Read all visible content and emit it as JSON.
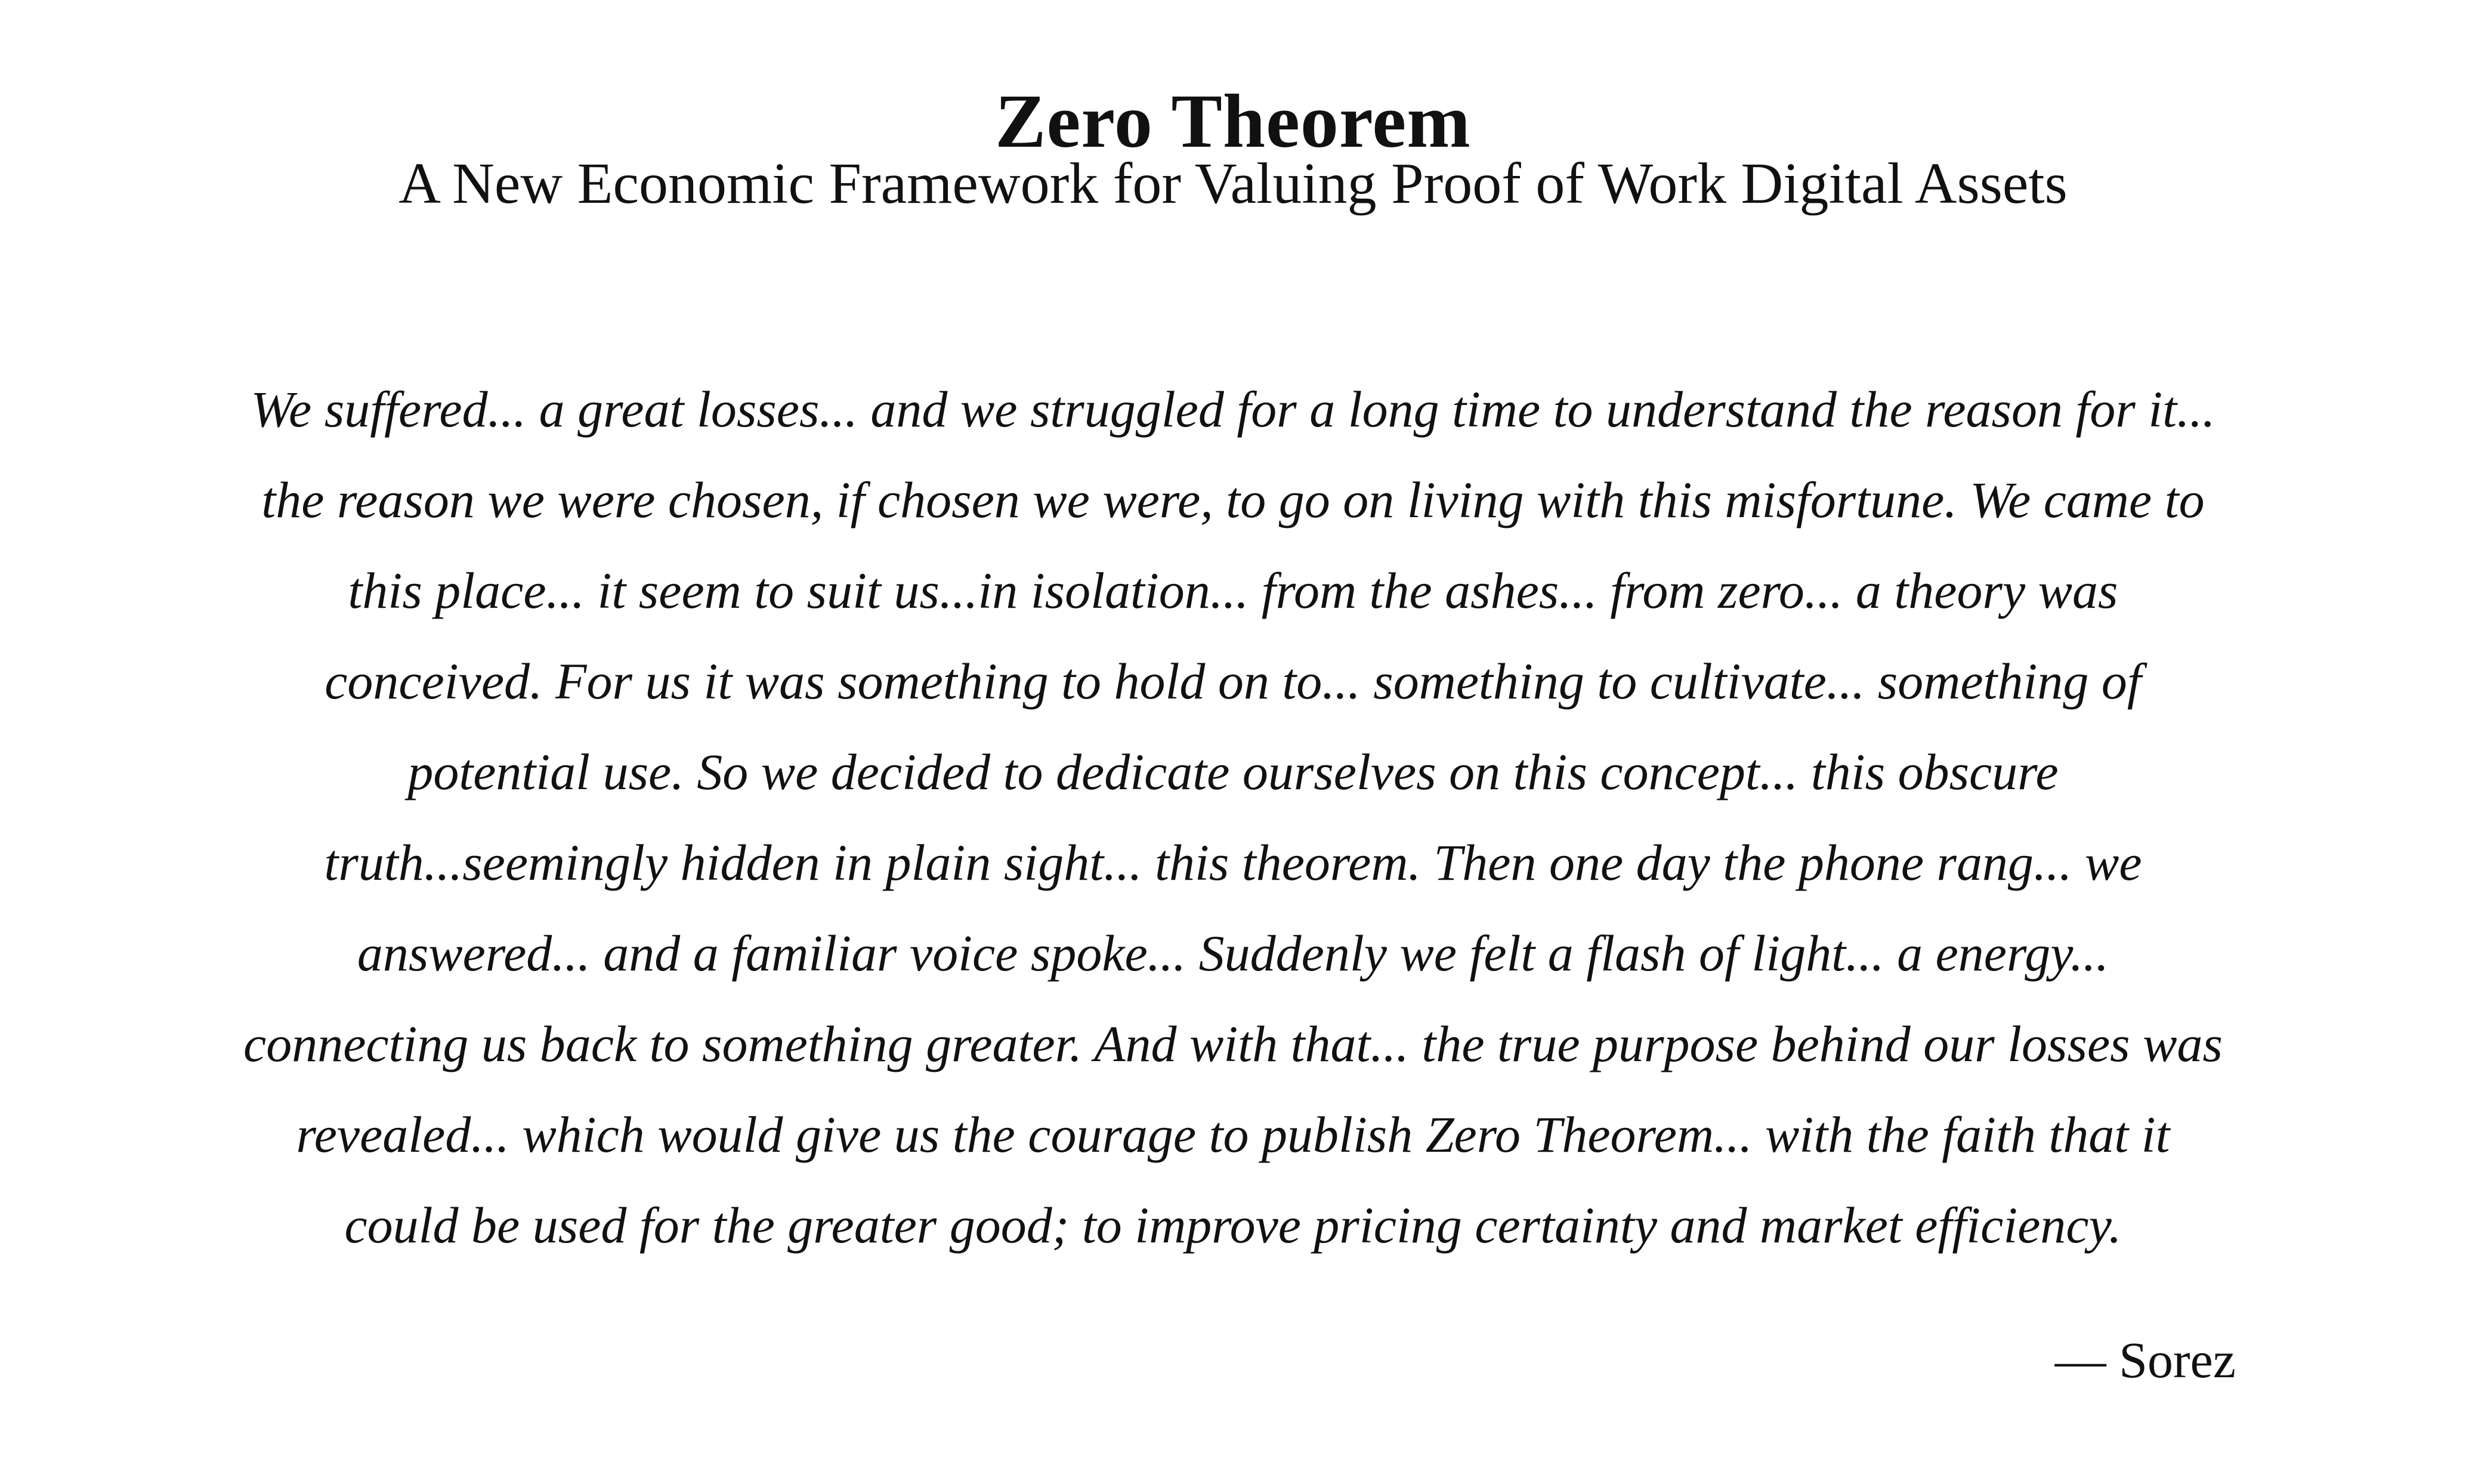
{
  "document": {
    "title": "Zero Theorem",
    "subtitle": "A New Economic Framework for Valuing Proof of Work Digital Assets",
    "epigraph": {
      "text": "We suffered... a great losses... and we struggled for a long time to understand the reason for it... the reason we were chosen, if chosen we were, to go on living with this misfortune. We came to this place... it seem to suit us...in isolation... from the ashes... from zero... a theory was conceived. For us it was something to hold on to... something to cultivate... something of potential use. So we decided to dedicate ourselves on this concept... this obscure truth...seemingly hidden in plain sight... this theorem. Then one day the phone rang... we answered... and a familiar voice spoke... Suddenly we felt a flash of light... a energy... connecting us back to something greater. And with that... the true purpose behind our losses was revealed... which would give us the courage to publish Zero Theorem... with the faith that it could be used for the greater good; to improve pricing certainty and market efficiency.",
      "attribution": "— Sorez"
    }
  }
}
